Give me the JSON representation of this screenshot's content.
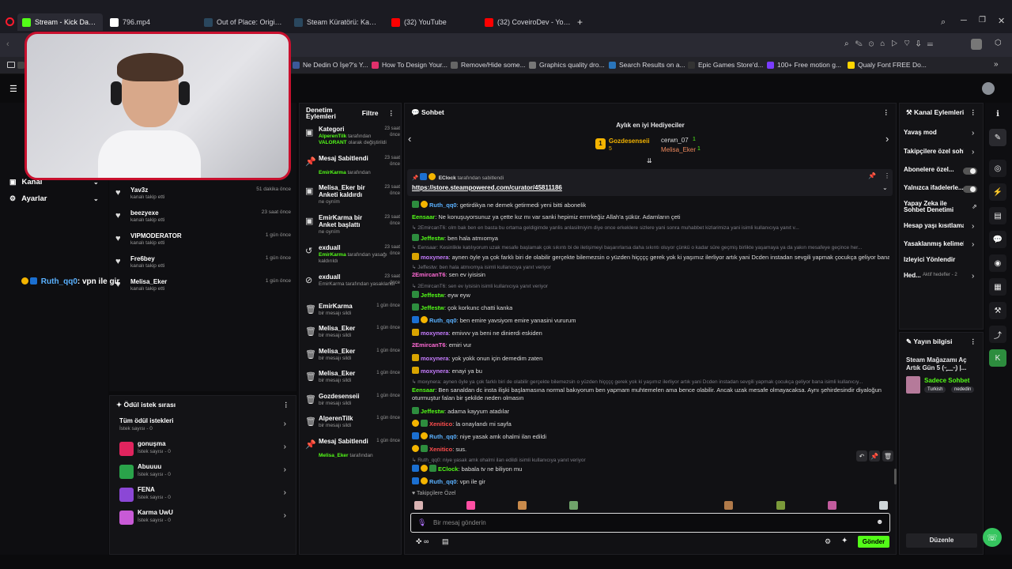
{
  "browser": {
    "tabs": [
      {
        "label": "Stream - Kick Dashboard",
        "color": "#53fc18",
        "active": true
      },
      {
        "label": "796.mp4",
        "color": "#ffffff",
        "active": false
      },
      {
        "label": "Out of Place: Origin Steam",
        "color": "#2a475e",
        "active": false
      },
      {
        "label": "Steam Küratörü: Karma St",
        "color": "#2a475e",
        "active": false
      },
      {
        "label": "(32) YouTube",
        "color": "#ff0000",
        "active": false
      },
      {
        "label": "(32) CoveiroDev - YouTub",
        "color": "#ff0000",
        "active": false
      }
    ],
    "new_tab": "+",
    "bookmarks": [
      {
        "label": "un",
        "color": "#444"
      },
      {
        "label": "Ne Dedin O İşe?'s Y...",
        "color": "#3b5998"
      },
      {
        "label": "How To Design Your...",
        "color": "#e1306c"
      },
      {
        "label": "Remove/Hide some...",
        "color": "#666"
      },
      {
        "label": "Graphics quality dro...",
        "color": "#777"
      },
      {
        "label": "Search Results on a...",
        "color": "#2a75bb"
      },
      {
        "label": "Epic Games Store'd...",
        "color": "#333"
      },
      {
        "label": "100+ Free motion g...",
        "color": "#7a3cff"
      },
      {
        "label": "Qualy Font FREE Do...",
        "color": "#ffd500"
      }
    ]
  },
  "overlay": {
    "username": "Ruth_qq0",
    "message": ": vpn ile gir"
  },
  "leftnav": {
    "items": [
      "Kanal",
      "Ayarlar"
    ]
  },
  "follows": [
    {
      "name": "Yav3z",
      "sub": "kanalı takip etti",
      "time": "51 dakika önce"
    },
    {
      "name": "beezyexe",
      "sub": "kanalı takip etti",
      "time": "23 saat önce"
    },
    {
      "name": "VIPMODERATOR",
      "sub": "kanalı takip etti",
      "time": "1 gün önce"
    },
    {
      "name": "Fre6bey",
      "sub": "kanalı takip etti",
      "time": "1 gün önce"
    },
    {
      "name": "Melisa_Eker",
      "sub": "kanalı takip etti",
      "time": "1 gün önce"
    }
  ],
  "rewards": {
    "title": "Ödül istek sırası",
    "all": {
      "name": "Tüm ödül istekleri",
      "count": "İstek sayısı - 0"
    },
    "items": [
      {
        "name": "gonuşma",
        "count": "İstek sayısı - 0",
        "color": "#e0245e"
      },
      {
        "name": "Abuuuu",
        "count": "İstek sayısı - 0",
        "color": "#2aa34a"
      },
      {
        "name": "FENA",
        "count": "İstek sayısı - 0",
        "color": "#8b47d6"
      },
      {
        "name": "Karma UwU",
        "count": "İstek sayısı - 0",
        "color": "#c85ad6"
      }
    ]
  },
  "moderation": {
    "title": "Denetim Eylemleri",
    "filter": "Filtre",
    "rows": [
      {
        "t1": "Kategori",
        "t2a": "AlperenTilk",
        "t2b": " tarafından",
        "t3a": "VALORANT",
        "t3b": " olarak değiştirildi",
        "time": "23 saat önce",
        "icon": "▣"
      },
      {
        "t1": "Mesaj Sabitlendi",
        "t2a": "EmirKarma",
        "t2b": " tarafından",
        "t3a": "",
        "t3b": "",
        "time": "23 saat önce",
        "icon": "📌"
      },
      {
        "t1": "Melisa_Eker bir Anketi kaldırdı",
        "t2a": "",
        "t2b": "",
        "t3a": "",
        "t3b": "ne oyním",
        "time": "23 saat önce",
        "icon": "▣"
      },
      {
        "t1": "EmirKarma bir Anket başlattı",
        "t2a": "",
        "t2b": "",
        "t3a": "",
        "t3b": "ne oyním",
        "time": "23 saat önce",
        "icon": "▣"
      },
      {
        "t1": "exduall",
        "t2a": "EmirKarma",
        "t2b": " tarafından yasağı kaldırıldı",
        "t3a": "",
        "t3b": "",
        "time": "23 saat önce",
        "icon": "↺"
      },
      {
        "t1": "exduall",
        "t2a": "",
        "t2b": "EmirKarma tarafından yasaklandı",
        "t3a": "",
        "t3b": "",
        "time": "23 saat önce",
        "icon": "⊘"
      },
      {
        "t1": "EmirKarma",
        "t2a": "",
        "t2b": "bir mesajı sildi",
        "t3a": "",
        "t3b": "",
        "time": "1 gün önce",
        "icon": "🗑"
      },
      {
        "t1": "Melisa_Eker",
        "t2a": "",
        "t2b": "bir mesajı sildi",
        "t3a": "",
        "t3b": "",
        "time": "1 gün önce",
        "icon": "🗑"
      },
      {
        "t1": "Melisa_Eker",
        "t2a": "",
        "t2b": "bir mesajı sildi",
        "t3a": "",
        "t3b": "",
        "time": "1 gün önce",
        "icon": "🗑"
      },
      {
        "t1": "Melisa_Eker",
        "t2a": "",
        "t2b": "bir mesajı sildi",
        "t3a": "",
        "t3b": "",
        "time": "1 gün önce",
        "icon": "🗑"
      },
      {
        "t1": "Gozdesenseii",
        "t2a": "",
        "t2b": "bir mesajı sildi",
        "t3a": "",
        "t3b": "",
        "time": "1 gün önce",
        "icon": "🗑"
      },
      {
        "t1": "AlperenTilk",
        "t2a": "",
        "t2b": "bir mesajı sildi",
        "t3a": "",
        "t3b": "",
        "time": "1 gün önce",
        "icon": "🗑"
      },
      {
        "t1": "Mesaj Sabitlendi",
        "t2a": "Melisa_Eker",
        "t2b": " tarafından",
        "t3a": "",
        "t3b": "",
        "time": "1 gün önce",
        "icon": "📌"
      }
    ]
  },
  "chat": {
    "title": "Sohbet",
    "gifters_title": "Aylık en iyi Hediyeciler",
    "gifters": [
      {
        "name": "Gozdesenseii",
        "count": "5",
        "rank": "1"
      },
      {
        "name": "cerwn_07",
        "count": "1"
      },
      {
        "name": "Melisa_Eker",
        "count": "1"
      }
    ],
    "pinned": {
      "by": "EClock",
      "by_suffix": " tarafından sabitlendi",
      "link": "https://store.steampowered.com/curator/45811186"
    },
    "messages": [
      {
        "kind": "msg",
        "user": "Ruth_qq0",
        "ucolor": "#5ab1ff",
        "text": ": getirdikya ne demek getirmedi yeni bitti abonelik",
        "badges": [
          "green",
          "gold"
        ]
      },
      {
        "kind": "msg",
        "user": "Eensaar",
        "ucolor": "#53fc18",
        "text": ": Ne konuşuyorsunuz ya çette kız mı var sanki hepimiz errrrkeğiz Allah'a şükür. Adamların çeti",
        "badges": []
      },
      {
        "kind": "reply",
        "text": "↳ 2EmircanT6: olm bak ben en basta bu ortama geldigimde yanlis anlasilmiyim diye once erkeklere sizlere yani sonra muhabbet kizlarimiza yani isimli kullanıcıya yanıt v..."
      },
      {
        "kind": "msg",
        "user": "Jeffestw",
        "ucolor": "#53fc18",
        "text": ": ben hala atmıomya",
        "badges": [
          "shield"
        ]
      },
      {
        "kind": "reply",
        "text": "↳ Eensaar: Kesinlikle katılıyorum uzak mesafe başlamak çok sıkıntı bi de iletişimeyi başarırlarsa daha sıkıntı oluyor çünkü o kadar süre geçmiş birlikte yaşamaya ya da yakın mesafeye geçince her..."
      },
      {
        "kind": "msg",
        "user": "moxynera",
        "ucolor": "#c77dff",
        "text": ": aynen öyle ya çok farklı biri de olabilir gerçekte bilemezsin o yüzden hiçççç gerek yok ki yaşımız ilerliyor artık yani Dcden instadan sevgili yapmak çocukça geliyor bana",
        "badges": [
          "crown"
        ]
      },
      {
        "kind": "reply",
        "text": "↳ Jeffestw: ben hala atmıomya isimli kullanıcıya yanıt veriyor"
      },
      {
        "kind": "msg",
        "user": "2EmircanT6",
        "ucolor": "#ff6ad5",
        "text": ": sen ev iyisisin",
        "badges": []
      },
      {
        "kind": "reply",
        "text": "↳ 2EmircanT6: sen ev iyisisin isimli kullanıcıya yanıt veriyor"
      },
      {
        "kind": "msg",
        "user": "Jeffestw",
        "ucolor": "#53fc18",
        "text": ": eyw eyw",
        "badges": [
          "shield"
        ]
      },
      {
        "kind": "msg",
        "user": "Jeffestw",
        "ucolor": "#53fc18",
        "text": ": çok korkunc chatti kanka",
        "badges": [
          "shield"
        ]
      },
      {
        "kind": "msg",
        "user": "Ruth_qq0",
        "ucolor": "#5ab1ff",
        "text": ": ben emire yavsiyom emire yanasini vururum",
        "badges": [
          "blue",
          "gold"
        ]
      },
      {
        "kind": "msg",
        "user": "moxynera",
        "ucolor": "#c77dff",
        "text": ": emivvv ya beni ne dinierdi eskiden",
        "badges": [
          "crown"
        ]
      },
      {
        "kind": "msg",
        "user": "2EmircanT6",
        "ucolor": "#ff6ad5",
        "text": ": emiri vur",
        "badges": []
      },
      {
        "kind": "msg",
        "user": "moxynera",
        "ucolor": "#c77dff",
        "text": ": yok yokk onun için demedim zaten",
        "badges": [
          "crown"
        ]
      },
      {
        "kind": "msg",
        "user": "moxynera",
        "ucolor": "#c77dff",
        "text": ": enayi ya bu",
        "badges": [
          "crown"
        ]
      },
      {
        "kind": "reply",
        "text": "↳ moxynera: aynen öyle ya çok farklı biri de olabilir gerçekte bilemezsin o yüzden hiçççç gerek yok ki yaşımız ilerliyor artık yani Dcden instadan sevgili yapmak çocukça geliyor bana isimli kullanıcıy..."
      },
      {
        "kind": "msg",
        "user": "Eensaar",
        "ucolor": "#53fc18",
        "text": ": Ben sanaldan dc insta ilişki başlamasına normal bakıyorum ben yapmam muhtemelen ama bence olabilir. Ancak uzak mesafe olmayacaksa. Aynı şehirdesindir diyaloğun",
        "badges": []
      },
      {
        "kind": "cont",
        "text": "oturmuştur falan bir şekilde neden olmasın"
      },
      {
        "kind": "msg",
        "user": "Jeffestw",
        "ucolor": "#53fc18",
        "text": ": adama kayyum atadılar",
        "badges": [
          "shield"
        ]
      },
      {
        "kind": "msg",
        "user": "Xenitico",
        "ucolor": "#ff4d4d",
        "text": ": la onaylandı mi sayfa",
        "badges": [
          "gold",
          "shield"
        ]
      },
      {
        "kind": "msg",
        "user": "Ruth_qq0",
        "ucolor": "#5ab1ff",
        "text": ": niye yasak amk ohalmi ilan edildi",
        "badges": [
          "blue",
          "gold"
        ]
      },
      {
        "kind": "msg",
        "user": "Xenitico",
        "ucolor": "#ff4d4d",
        "text": ": sus.",
        "badges": [
          "gold",
          "shield"
        ]
      },
      {
        "kind": "reply",
        "text": "↳ Ruth_qq0: niye yasak amk ohalmi ilan edildi isimli kullanıcıya yanıt veriyor"
      },
      {
        "kind": "msg",
        "user": "EClock",
        "ucolor": "#53fc18",
        "text": ": babala tv ne biliyon mu",
        "badges": [
          "blue",
          "gold",
          "shield"
        ]
      },
      {
        "kind": "msg",
        "user": "Ruth_qq0",
        "ucolor": "#5ab1ff",
        "text": ": vpn ile gir",
        "badges": [
          "blue",
          "gold"
        ]
      }
    ],
    "followers_only": "Takipçilere Özel",
    "input_placeholder": "Bir mesaj gönderin",
    "send": "Gönder"
  },
  "channel_actions": {
    "title": "Kanal Eylemleri",
    "items": [
      "Yavaş mod",
      "Takipçilere özel sohbet",
      "Abonelere özel...",
      "Yalnızca ifadelerle...",
      "Yapay Zeka ile Sohbet Denetimi",
      "Hesap yaşı kısıtlaması",
      "Yasaklanmış kelimeler",
      "İzleyici Yönlendir",
      "Hed..."
    ],
    "hed_sub": "Aktif hedefler - 2"
  },
  "stream_info": {
    "title": "Yayın bilgisi",
    "stream_title": "Steam Mağazamı Aç Artık Gün 5 (ᵕ̣̣̣̣̣̣﹏ᵕ̣̣̣̣̣̣) |...",
    "chat_mode": "Sadece Sohbet",
    "tags": [
      "Turkish",
      "nededin"
    ],
    "edit": "Düzenle"
  }
}
